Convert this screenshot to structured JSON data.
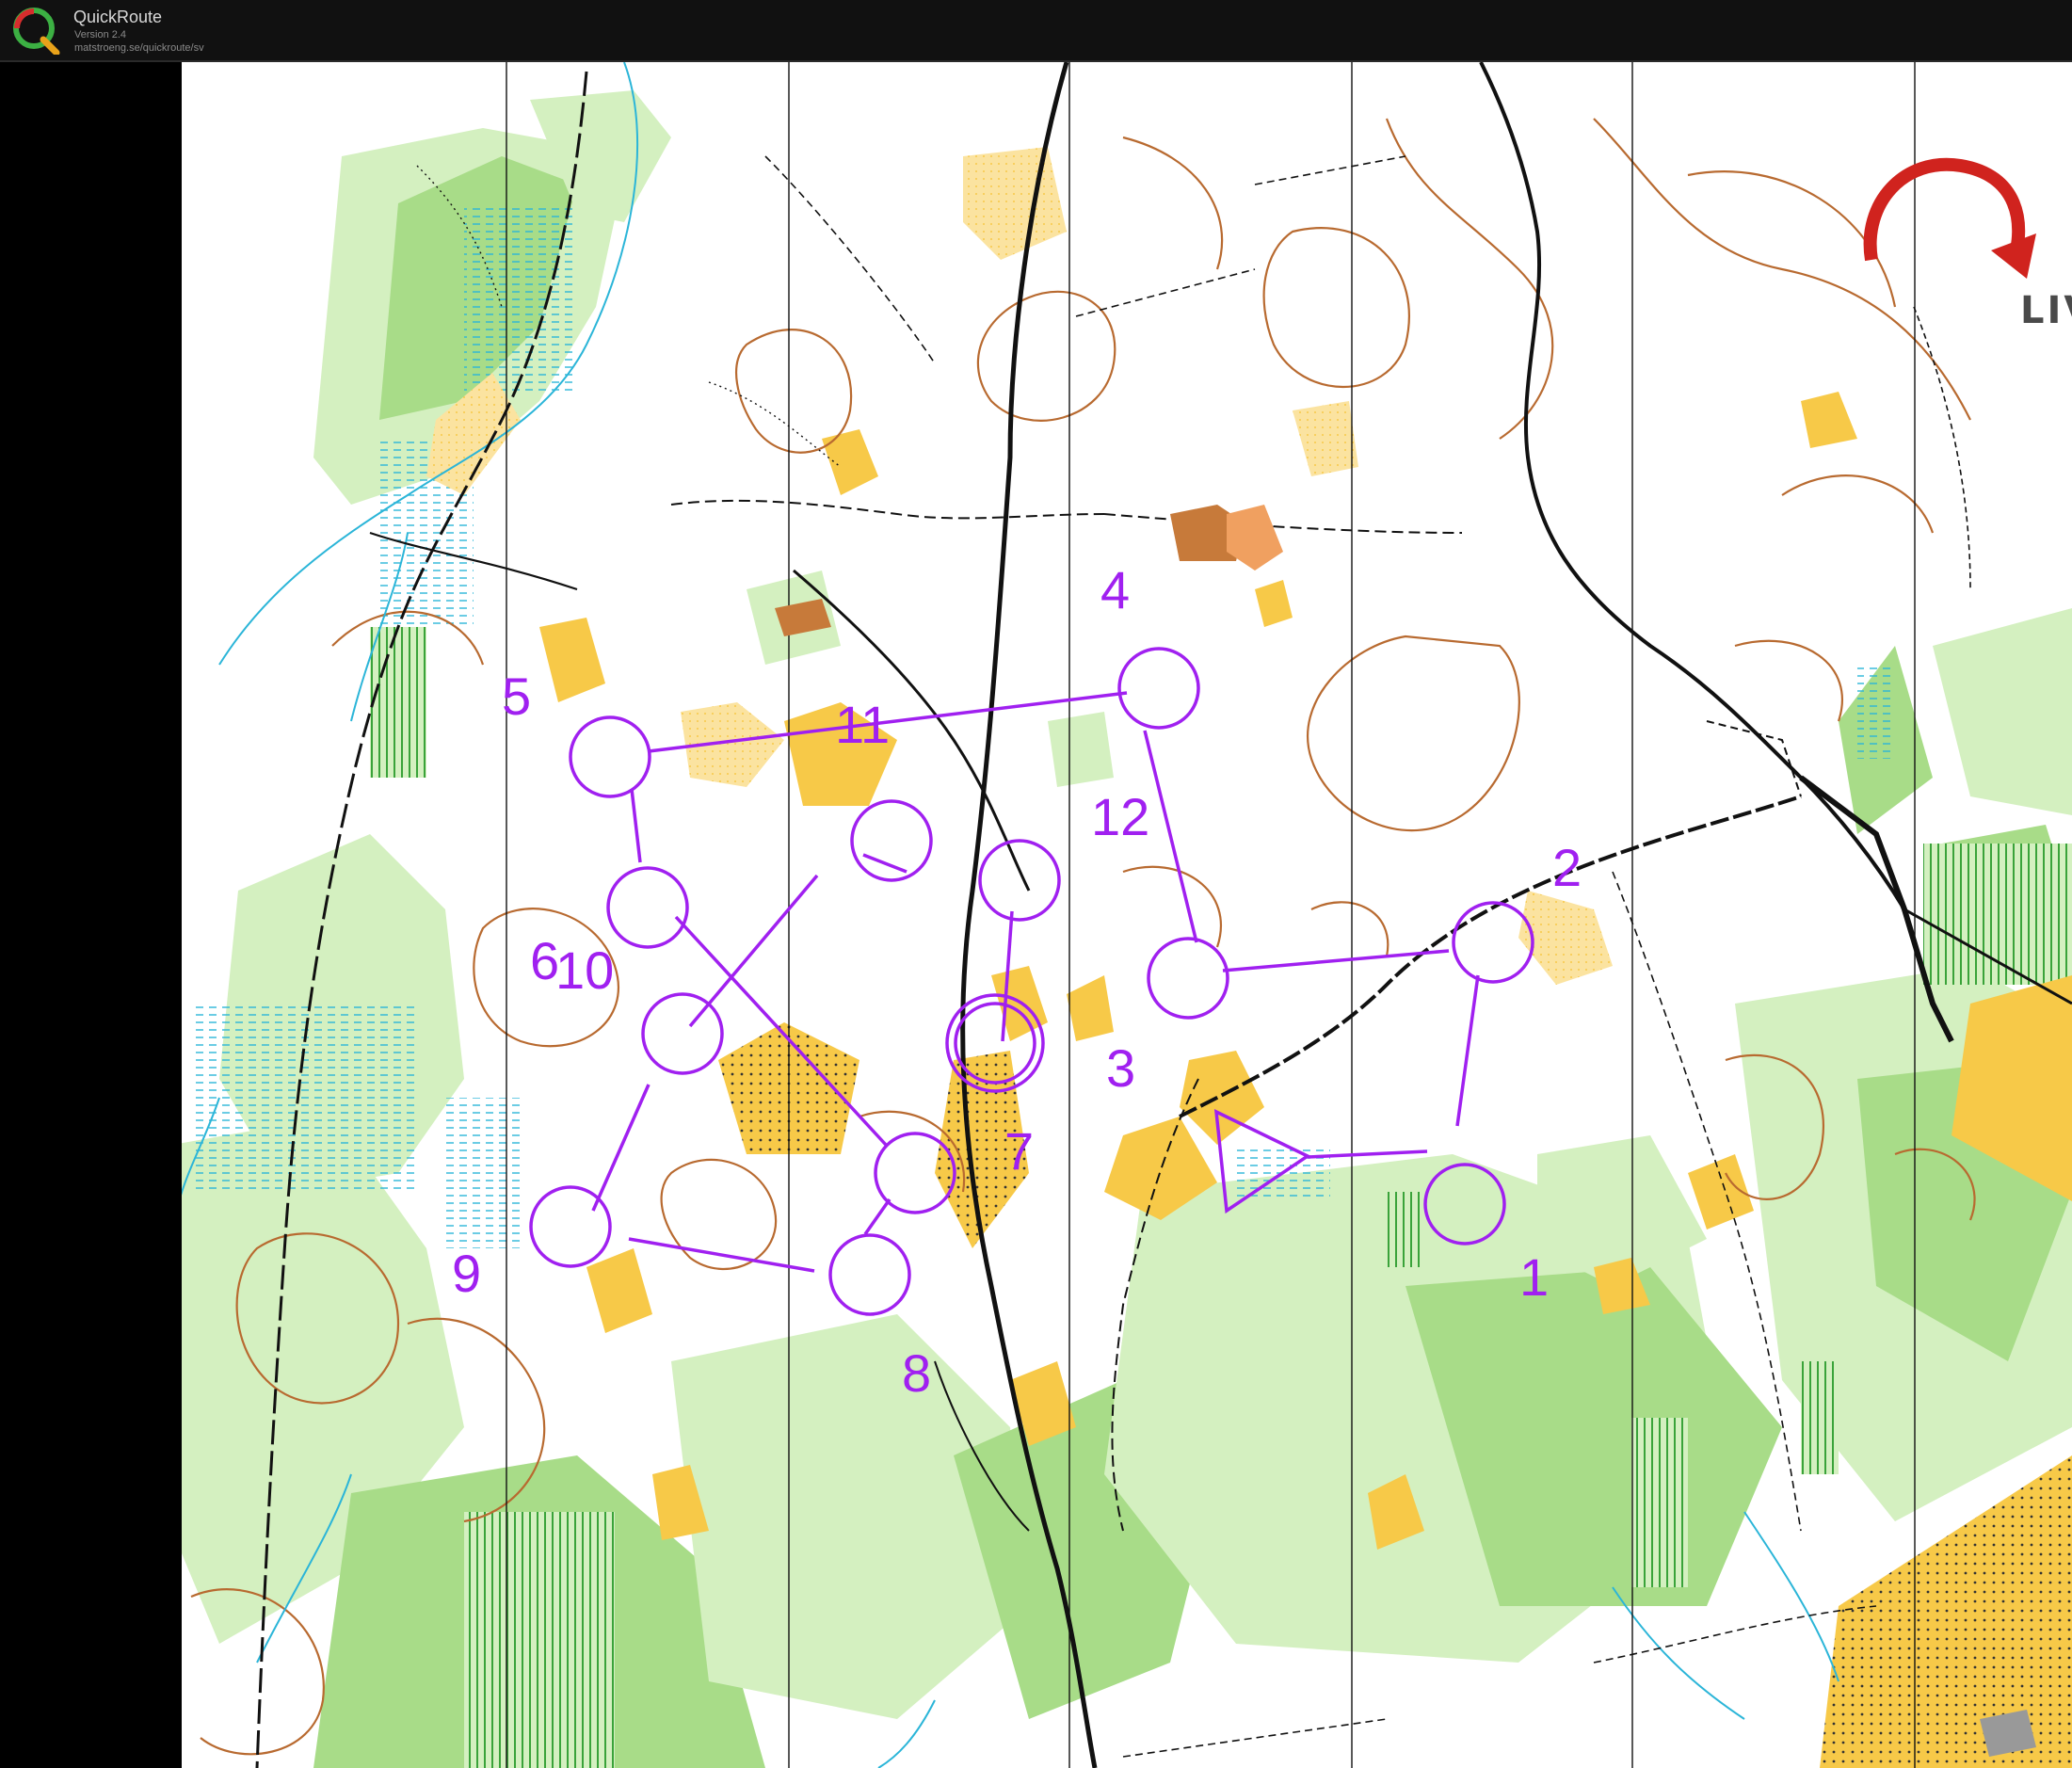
{
  "app": {
    "title": "QuickRoute",
    "version": "Version 2.4",
    "url": "matstroeng.se/quickroute/sv"
  },
  "watermark": {
    "text": "LIVELOX"
  },
  "course": {
    "color": "#a020f0",
    "start": {
      "symbol": "start-triangle"
    },
    "controls": [
      {
        "label": "1"
      },
      {
        "label": "2"
      },
      {
        "label": "3"
      },
      {
        "label": "4"
      },
      {
        "label": "5"
      },
      {
        "label": "6"
      },
      {
        "label": "10"
      },
      {
        "label": "7"
      },
      {
        "label": "8"
      },
      {
        "label": "9"
      },
      {
        "label": "11"
      },
      {
        "label": "12"
      }
    ]
  },
  "map_colors": {
    "open_land": "#f7c948",
    "rough_open": "#fbe3a0",
    "forest_light_green": "#d4f0c0",
    "forest_green": "#a8dc88",
    "water_blue": "#2bb5d8",
    "contour_brown": "#b86a30",
    "track_black": "#111111"
  }
}
